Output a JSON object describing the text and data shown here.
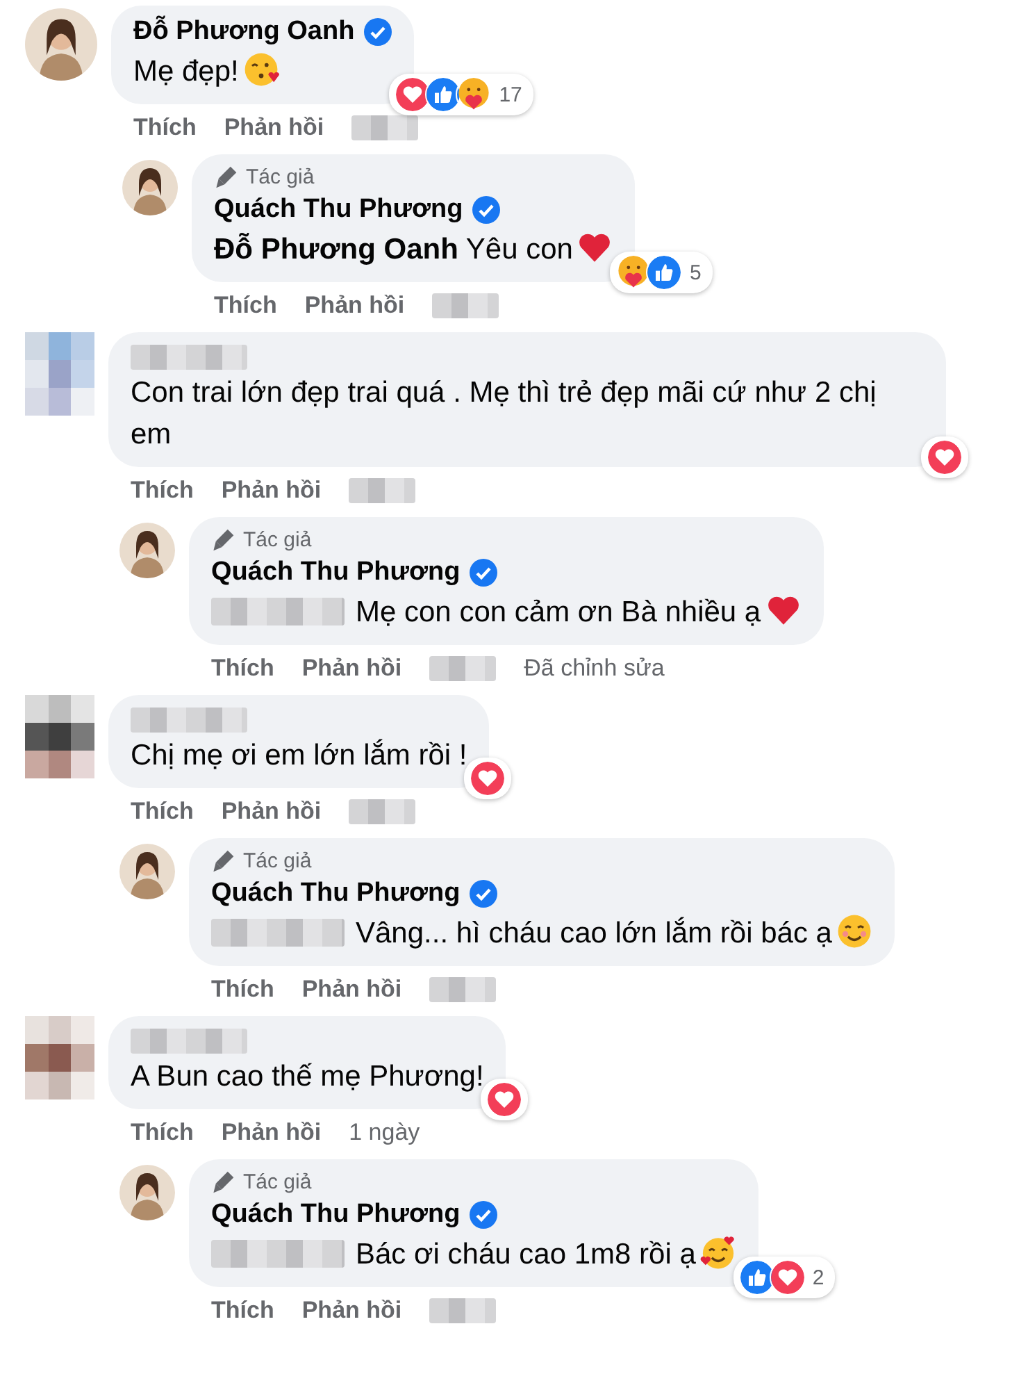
{
  "comments": [
    {
      "avatar": {
        "kind": "photo"
      },
      "author": "Đỗ Phương Oanh",
      "verified": true,
      "text": "Mẹ đẹp!",
      "emoji": {
        "kind": "kiss"
      },
      "reactions": [
        {
          "kind": "love"
        },
        {
          "kind": "like"
        },
        {
          "kind": "care"
        }
      ],
      "reaction_count": "17",
      "actions": [
        "Thích",
        "Phản hồi"
      ],
      "time_blurred": true,
      "children": [
        {
          "avatar": {
            "kind": "photo"
          },
          "author_badge": "Tác giả",
          "author": "Quách Thu Phương",
          "verified": true,
          "text": "**Đỗ Phương Oanh** Yêu con",
          "emoji": {
            "kind": "heart"
          },
          "reactions": [
            {
              "kind": "care"
            },
            {
              "kind": "like"
            }
          ],
          "reaction_count": "5",
          "actions": [
            "Thích",
            "Phản hồi"
          ],
          "time_blurred": true
        }
      ]
    },
    {
      "avatar": {
        "kind": "pixelated"
      },
      "author_blurred": true,
      "text": "Con trai lớn đẹp trai quá . Mẹ thì trẻ đẹp mãi cứ như 2 chị em",
      "reactions": [
        {
          "kind": "love"
        }
      ],
      "actions": [
        "Thích",
        "Phản hồi"
      ],
      "time_blurred": true,
      "children": [
        {
          "avatar": {
            "kind": "photo"
          },
          "author_badge": "Tác giả",
          "author": "Quách Thu Phương",
          "verified": true,
          "mention_blurred": true,
          "text": "Mẹ con con cảm ơn Bà nhiều ạ",
          "emoji": {
            "kind": "heart"
          },
          "actions": [
            "Thích",
            "Phản hồi"
          ],
          "time_blurred": true,
          "edited": "Đã chỉnh sửa"
        }
      ]
    },
    {
      "avatar": {
        "kind": "pixelated"
      },
      "author_blurred": true,
      "text": "Chị mẹ ơi em lớn lắm rồi !",
      "reactions": [
        {
          "kind": "love"
        }
      ],
      "actions": [
        "Thích",
        "Phản hồi"
      ],
      "time_blurred": true,
      "children": [
        {
          "avatar": {
            "kind": "photo"
          },
          "author_badge": "Tác giả",
          "author": "Quách Thu Phương",
          "verified": true,
          "mention_blurred": true,
          "text": "Vâng... hì cháu cao lớn lắm rồi bác ạ",
          "emoji": {
            "kind": "smile"
          },
          "actions": [
            "Thích",
            "Phản hồi"
          ],
          "time_blurred": true
        }
      ]
    },
    {
      "avatar": {
        "kind": "pixelated"
      },
      "author_blurred": true,
      "text": "A Bun cao thế mẹ Phương!",
      "reactions": [
        {
          "kind": "love"
        }
      ],
      "actions": [
        "Thích",
        "Phản hồi"
      ],
      "time": "1 ngày",
      "children": [
        {
          "avatar": {
            "kind": "photo"
          },
          "author_badge": "Tác giả",
          "author": "Quách Thu Phương",
          "verified": true,
          "mention_blurred": true,
          "text": "Bác ơi cháu cao 1m8 rồi ạ",
          "emoji": {
            "kind": "hearts-face"
          },
          "reactions": [
            {
              "kind": "like"
            },
            {
              "kind": "love"
            }
          ],
          "reaction_count": "2",
          "actions": [
            "Thích",
            "Phản hồi"
          ],
          "time_blurred": true
        }
      ]
    }
  ]
}
